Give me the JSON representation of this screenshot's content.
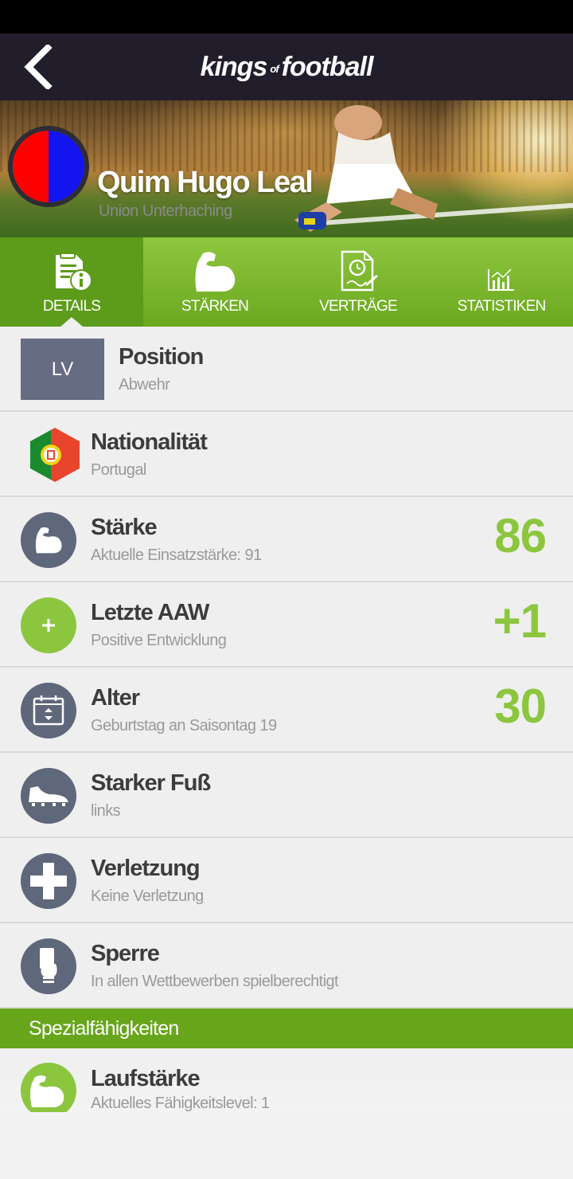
{
  "app": {
    "logo_part1": "kings",
    "logo_of": "of",
    "logo_part2": "football"
  },
  "player": {
    "name": "Quim Hugo Leal",
    "club": "Union Unterhaching",
    "club_colors": [
      "#ff0000",
      "#1414f0"
    ]
  },
  "tabs": [
    {
      "label": "DETAILS",
      "icon": "details-info-icon",
      "active": true
    },
    {
      "label": "STÄRKEN",
      "icon": "bicep-icon",
      "active": false
    },
    {
      "label": "VERTRÄGE",
      "icon": "contract-icon",
      "active": false
    },
    {
      "label": "STATISTIKEN",
      "icon": "statistics-chart-icon",
      "active": false
    }
  ],
  "details": {
    "position": {
      "badge": "LV",
      "title": "Position",
      "sub": "Abwehr"
    },
    "nationality": {
      "title": "Nationalität",
      "sub": "Portugal",
      "icon": "portugal-flag-icon"
    },
    "strength": {
      "title": "Stärke",
      "sub": "Aktuelle Einsatzstärke: 91",
      "value": "86",
      "icon": "bicep-icon"
    },
    "last_aaw": {
      "title": "Letzte AAW",
      "sub": "Positive Entwicklung",
      "value": "+1",
      "icon": "plus-icon"
    },
    "age": {
      "title": "Alter",
      "sub": "Geburtstag an Saisontag 19",
      "value": "30",
      "icon": "calendar-icon"
    },
    "foot": {
      "title": "Starker Fuß",
      "sub": "links",
      "icon": "football-boot-icon"
    },
    "injury": {
      "title": "Verletzung",
      "sub": "Keine Verletzung",
      "icon": "medical-cross-icon"
    },
    "ban": {
      "title": "Sperre",
      "sub": "In allen Wettbewerben spielberechtigt",
      "icon": "red-card-hand-icon"
    }
  },
  "special": {
    "header": "Spezialfähigkeiten",
    "items": [
      {
        "title": "Laufstärke",
        "sub": "Aktuelles Fähigkeitslevel: 1",
        "icon": "runner-icon"
      }
    ]
  },
  "colors": {
    "accent_green": "#8cc63f",
    "header_dark": "#221d2b",
    "icon_grey": "#5f677a"
  }
}
